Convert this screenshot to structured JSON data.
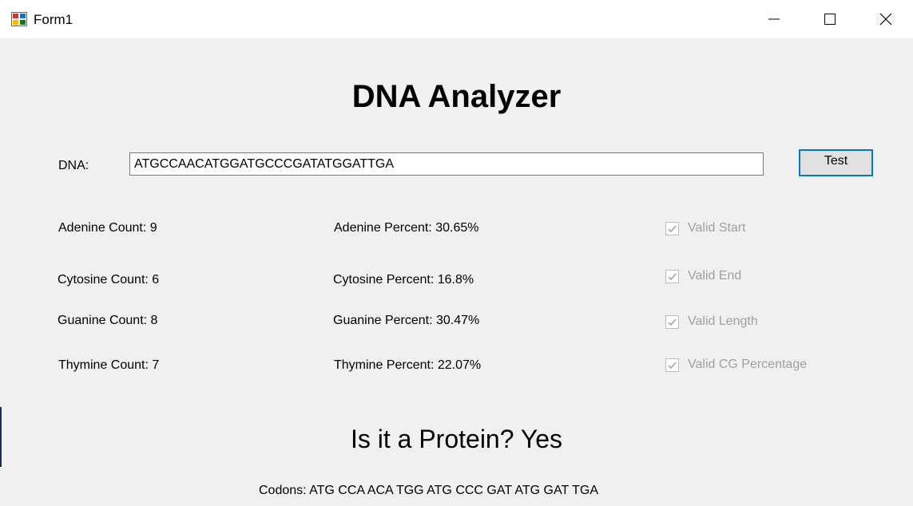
{
  "window": {
    "title": "Form1"
  },
  "header": {
    "title": "DNA Analyzer"
  },
  "input": {
    "label": "DNA:",
    "value": "ATGCCAACATGGATGCCCGATATGGATTGA"
  },
  "test_button": {
    "label": "Test"
  },
  "counts": [
    {
      "label": "Adenine Count: 9"
    },
    {
      "label": "Cytosine Count: 6"
    },
    {
      "label": "Guanine Count: 8"
    },
    {
      "label": "Thymine Count: 7"
    }
  ],
  "percents": [
    {
      "label": "Adenine Percent: 30.65%"
    },
    {
      "label": "Cytosine Percent: 16.8%"
    },
    {
      "label": "Guanine Percent: 30.47%"
    },
    {
      "label": "Thymine Percent: 22.07%"
    }
  ],
  "checks": [
    {
      "label": "Valid Start",
      "checked": true
    },
    {
      "label": "Valid End",
      "checked": true
    },
    {
      "label": "Valid Length",
      "checked": true
    },
    {
      "label": "Valid CG Percentage",
      "checked": true
    }
  ],
  "result": {
    "protein": "Is it a Protein? Yes"
  },
  "codons": {
    "text": "Codons: ATG CCA ACA TGG ATG CCC GAT ATG GAT TGA"
  },
  "colors": {
    "accent": "#0078d7",
    "background": "#f0f0f0",
    "disabled_text": "#a0a0a0"
  }
}
